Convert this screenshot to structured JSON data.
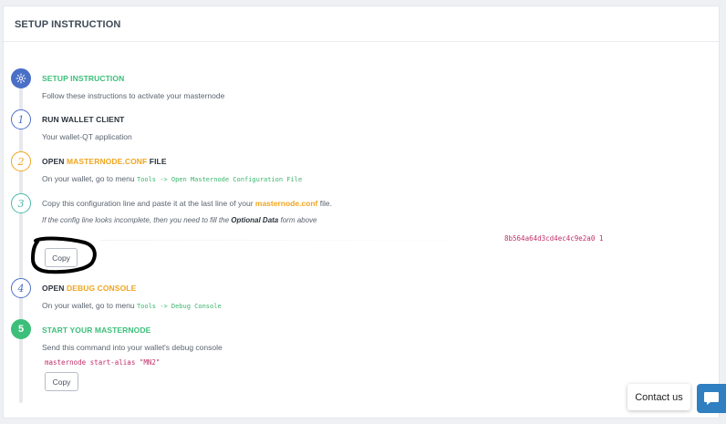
{
  "header": {
    "title": "SETUP INSTRUCTION"
  },
  "steps": {
    "intro": {
      "title": "SETUP INSTRUCTION",
      "desc": "Follow these instructions to activate your masternode"
    },
    "s1": {
      "number": "1",
      "title": "RUN WALLET CLIENT",
      "desc": "Your wallet-QT application"
    },
    "s2": {
      "number": "2",
      "title_pre": "OPEN ",
      "title_accent": "MASTERNODE.CONF",
      "title_post": " FILE",
      "desc": "On your wallet, go to menu ",
      "menu_path": "Tools -> Open Masternode Configuration File"
    },
    "s3": {
      "number": "3",
      "desc_pre": "Copy this configuration line and paste it at the last line of your ",
      "desc_accent": "masternode.conf",
      "desc_post": " file.",
      "note_pre": "If the config line looks incomplete, then you need to fill the ",
      "note_bold": "Optional Data",
      "note_post": " form above",
      "config_tail": "8b564a64d3cd4ec4c9e2a0 1",
      "copy_label": "Copy"
    },
    "s4": {
      "number": "4",
      "title_pre": "OPEN ",
      "title_accent": "DEBUG CONSOLE",
      "desc": "On your wallet, go to menu ",
      "menu_path": "Tools -> Debug Console"
    },
    "s5": {
      "number": "5",
      "title": "START YOUR MASTERNODE",
      "desc": "Send this command into your wallet's debug console",
      "command": "masternode start-alias \"MN2\"",
      "copy_label": "Copy"
    }
  },
  "widget": {
    "contact_label": "Contact us"
  },
  "colors": {
    "blue": "#4a6fc7",
    "orange": "#f0a51e",
    "green": "#3cbf7a",
    "teal": "#4bb8a9",
    "pink": "#c0306a"
  }
}
